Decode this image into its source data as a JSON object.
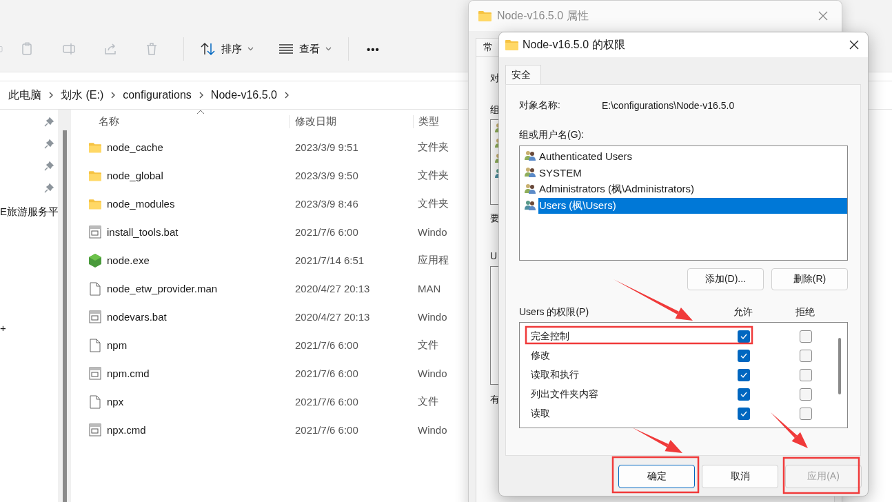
{
  "explorer": {
    "toolbar": {
      "sort": "排序",
      "view": "查看",
      "more": "•••"
    },
    "breadcrumb": [
      "此电脑",
      "划水 (E:)",
      "configurations",
      "Node-v16.5.0"
    ],
    "nav_items": [
      "E旅游服务平",
      "+"
    ],
    "columns": [
      "名称",
      "修改日期",
      "类型"
    ],
    "files": [
      {
        "name": "node_cache",
        "date": "2023/3/9 9:51",
        "type": "文件夹",
        "kind": "folder"
      },
      {
        "name": "node_global",
        "date": "2023/3/9 9:50",
        "type": "文件夹",
        "kind": "folder"
      },
      {
        "name": "node_modules",
        "date": "2023/3/9 8:46",
        "type": "文件夹",
        "kind": "folder"
      },
      {
        "name": "install_tools.bat",
        "date": "2021/7/6 6:00",
        "type": "Windo",
        "kind": "script"
      },
      {
        "name": "node.exe",
        "date": "2021/7/14 6:51",
        "type": "应用程",
        "kind": "app"
      },
      {
        "name": "node_etw_provider.man",
        "date": "2020/4/27 20:13",
        "type": "MAN",
        "kind": "document"
      },
      {
        "name": "nodevars.bat",
        "date": "2020/4/27 20:13",
        "type": "Windo",
        "kind": "script"
      },
      {
        "name": "npm",
        "date": "2021/7/6 6:00",
        "type": "文件",
        "kind": "document"
      },
      {
        "name": "npm.cmd",
        "date": "2021/7/6 6:00",
        "type": "Windo",
        "kind": "script"
      },
      {
        "name": "npx",
        "date": "2021/7/6 6:00",
        "type": "文件",
        "kind": "document"
      },
      {
        "name": "npx.cmd",
        "date": "2021/7/6 6:00",
        "type": "Windo",
        "kind": "script"
      }
    ]
  },
  "properties": {
    "title": "Node-v16.5.0 属性",
    "tab": "常",
    "labels": [
      "对",
      "组",
      "要",
      "U",
      "有"
    ]
  },
  "permissions": {
    "title": "Node-v16.5.0 的权限",
    "tabs": [
      {
        "label": "安全",
        "selected": true
      }
    ],
    "object_label": "对象名称:",
    "object_value": "E:\\configurations\\Node-v16.5.0",
    "groups_label": "组或用户名(G):",
    "groups": [
      {
        "name": "Authenticated Users",
        "selected": false
      },
      {
        "name": "SYSTEM",
        "selected": false
      },
      {
        "name": "Administrators (枫\\Administrators)",
        "selected": false
      },
      {
        "name": "Users (枫\\Users)",
        "selected": true
      }
    ],
    "group_buttons": [
      "添加(D)...",
      "删除(R)"
    ],
    "perm_label": "Users 的权限(P)",
    "allow_header": "允许",
    "deny_header": "拒绝",
    "perms": [
      {
        "name": "完全控制",
        "allow": true,
        "deny": false
      },
      {
        "name": "修改",
        "allow": true,
        "deny": false
      },
      {
        "name": "读取和执行",
        "allow": true,
        "deny": false
      },
      {
        "name": "列出文件夹内容",
        "allow": true,
        "deny": false
      },
      {
        "name": "读取",
        "allow": true,
        "deny": false
      }
    ],
    "footer_buttons": [
      {
        "label": "确定",
        "kind": "default",
        "disabled": false
      },
      {
        "label": "取消",
        "kind": "normal",
        "disabled": false
      },
      {
        "label": "应用(A)",
        "kind": "normal",
        "disabled": true
      }
    ]
  }
}
